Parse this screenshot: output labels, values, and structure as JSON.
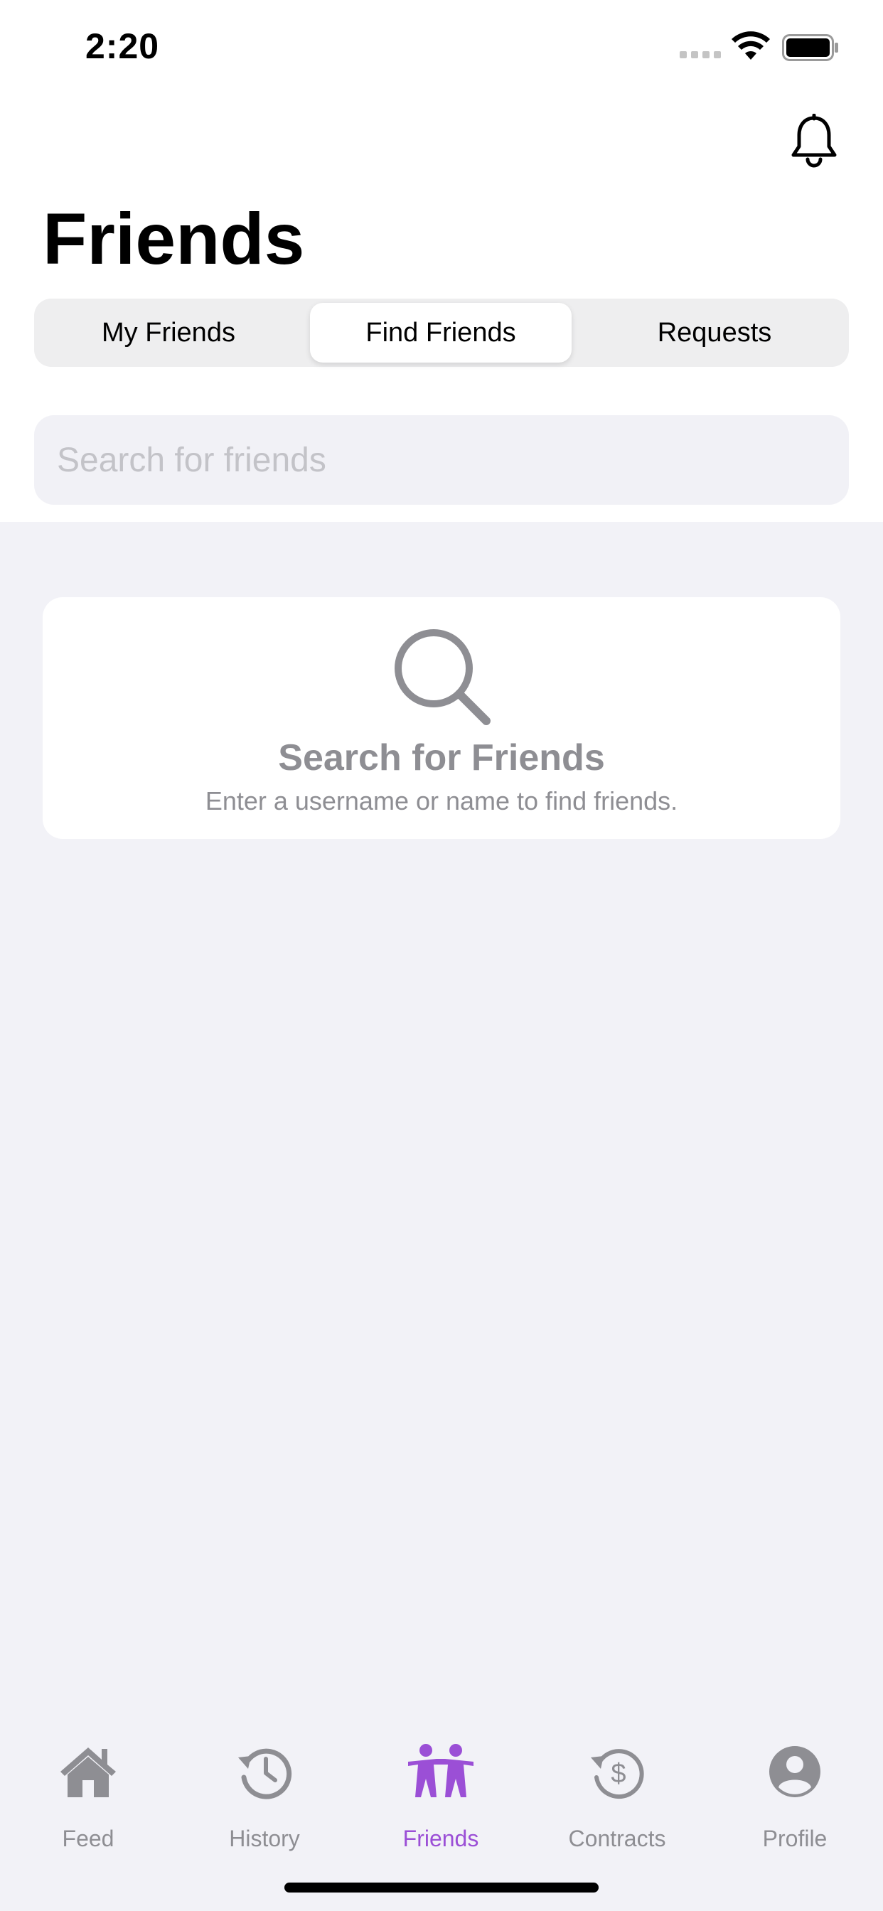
{
  "status_bar": {
    "time": "2:20"
  },
  "header": {
    "title": "Friends",
    "notification_icon": "bell-icon"
  },
  "segments": {
    "items": [
      {
        "label": "My Friends",
        "selected": false
      },
      {
        "label": "Find Friends",
        "selected": true
      },
      {
        "label": "Requests",
        "selected": false
      }
    ]
  },
  "search": {
    "placeholder": "Search for friends",
    "value": ""
  },
  "empty_state": {
    "icon": "search-icon",
    "title": "Search for Friends",
    "subtitle": "Enter a username or name to find friends."
  },
  "tab_bar": {
    "items": [
      {
        "label": "Feed",
        "icon": "home-icon",
        "active": false
      },
      {
        "label": "History",
        "icon": "history-icon",
        "active": false
      },
      {
        "label": "Friends",
        "icon": "friends-icon",
        "active": true
      },
      {
        "label": "Contracts",
        "icon": "contracts-icon",
        "active": false
      },
      {
        "label": "Profile",
        "icon": "profile-icon",
        "active": false
      }
    ]
  },
  "colors": {
    "accent": "#9b4fd6",
    "inactive": "#8e8e93",
    "background": "#f2f2f7"
  }
}
